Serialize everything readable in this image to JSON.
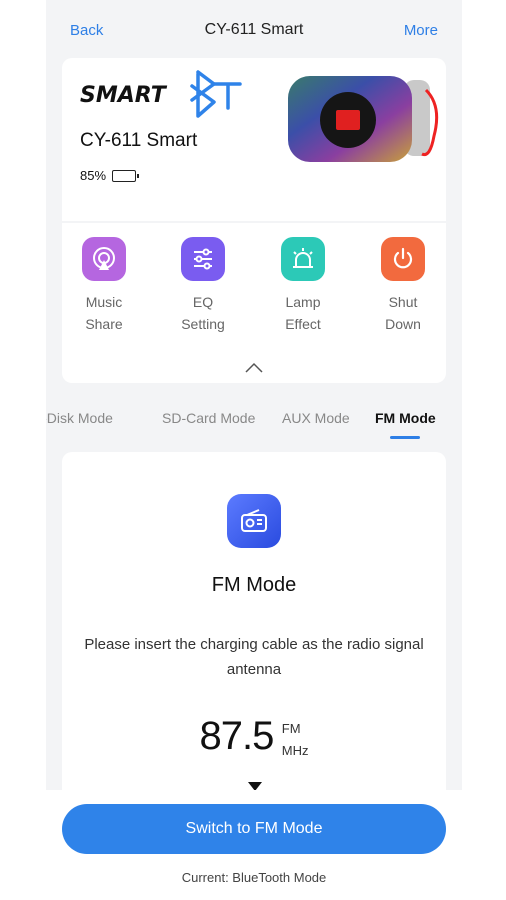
{
  "header": {
    "back_label": "Back",
    "title": "CY-611 Smart",
    "more_label": "More"
  },
  "device": {
    "logo_text": "SMARTBT",
    "name": "CY-611 Smart",
    "battery_percent": 85,
    "battery_text": "85%"
  },
  "functions": [
    {
      "label": "Music\nShare",
      "icon": "music-share-icon",
      "color": "#b566e0"
    },
    {
      "label": "EQ\nSetting",
      "icon": "eq-sliders-icon",
      "color": "#7a5cf0"
    },
    {
      "label": "Lamp\nEffect",
      "icon": "lamp-alarm-icon",
      "color": "#2cc9b7"
    },
    {
      "label": "Shut\nDown",
      "icon": "power-icon",
      "color": "#f26a3e"
    }
  ],
  "tabs": [
    {
      "label": "U-Disk Mode",
      "active": false
    },
    {
      "label": "SD-Card Mode",
      "active": false
    },
    {
      "label": "AUX Mode",
      "active": false
    },
    {
      "label": "FM Mode",
      "active": true
    }
  ],
  "fm": {
    "title": "FM Mode",
    "description": "Please insert the charging cable as the radio signal antenna",
    "frequency": "87.5",
    "unit_top": "FM",
    "unit_bottom": "MHz"
  },
  "bottom": {
    "switch_label": "Switch to FM Mode",
    "current_mode": "Current: BlueTooth Mode"
  },
  "colors": {
    "accent": "#2f83e9",
    "battery": "#3cc43c"
  }
}
